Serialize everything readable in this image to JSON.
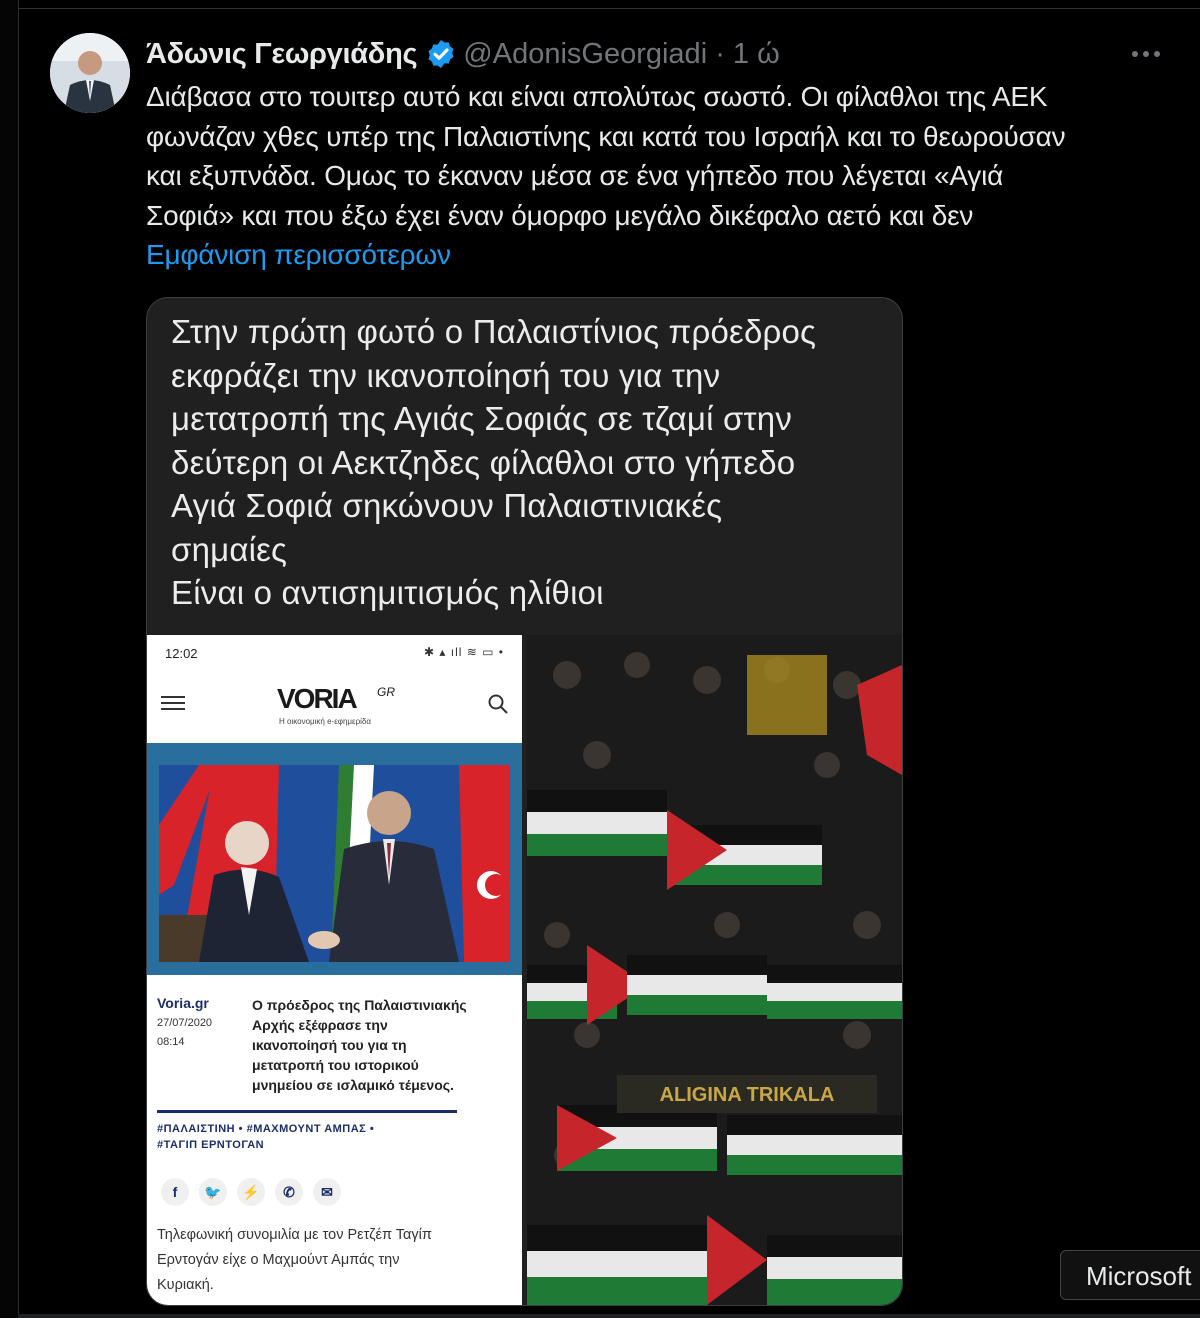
{
  "tweet": {
    "author_name": "Άδωνις Γεωργιάδης",
    "handle_time": "@AdonisGeorgiadi · 1 ώ",
    "text_lines": [
      "Διάβασα στο τουιτερ αυτό και είναι απολύτως σωστό. Οι φίλαθλοι της ΑΕΚ",
      "φωνάζαν χθες υπέρ της Παλαιστίνης και κατά του Ισραήλ και το θεωρούσαν",
      "και εξυπνάδα. Ομως το έκαναν μέσα σε ένα γήπεδο που λέγεται «Αγιά",
      "Σοφιά» και που έξω έχει έναν όμορφο μεγάλο δικέφαλο αετό και δεν"
    ],
    "show_more": "Εμφάνιση περισσότερων",
    "colors": {
      "accent": "#1d9bf0",
      "text": "#e7e9ea",
      "muted": "#71767b"
    }
  },
  "card": {
    "text_lines": [
      "Στην πρώτη φωτό ο Παλαιστίνιος πρόεδρος",
      "εκφράζει την ικανοποίησή του για την",
      "μετατροπή της Αγιάς Σοφιάς σε τζαμί στην",
      "δεύτερη οι Αεκτζηδες φίλαθλοι στο γήπεδο",
      "Αγιά Σοφιά σηκώνουν Παλαιστινιακές",
      "σημαίες",
      "Είναι ο αντισημιτισμός ηλίθιοι"
    ],
    "phone": {
      "status_time": "12:02",
      "logo": "VORIA",
      "logo_suffix": "GR",
      "logo_sub": "Η οικονομική e-εφημερίδα",
      "site": "Voria.gr",
      "date": "27/07/2020",
      "time": "08:14",
      "headline_lines": [
        "Ο πρόεδρος της Παλαιστινιακής",
        "Αρχής εξέφρασε την",
        "ικανοποίησή του για τη",
        "μετατροπή του ιστορικού",
        "μνημείου σε ισλαμικό τέμενος."
      ],
      "tags_lines": [
        "#ΠΑΛΑΙΣΤΙΝΗ  •  #ΜΑΧΜΟΥΝΤ ΑΜΠΑΣ  •",
        "#ΤΑΓΙΠ ΕΡΝΤΟΓΑΝ"
      ],
      "body_lines": [
        "Τηλεφωνική συνομιλία με τον Ρετζέπ Ταγίπ",
        "Ερντογάν είχε ο Μαχμούντ Αμπάς την",
        "Κυριακή."
      ]
    },
    "crowd_banner": "ALIGINA TRIKALA"
  },
  "overlay": {
    "label": "Microsoft"
  }
}
